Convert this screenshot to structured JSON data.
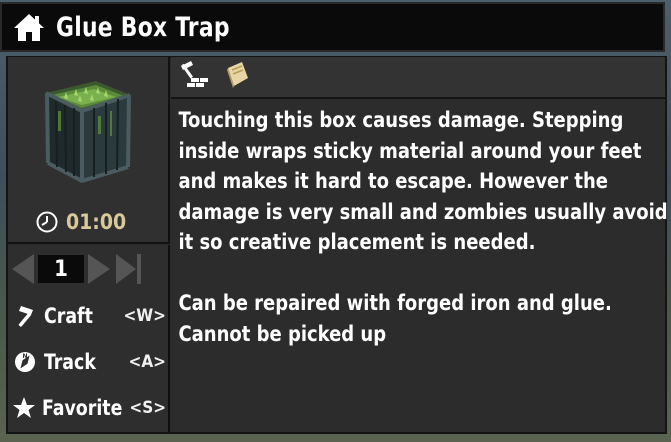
{
  "window": {
    "title": "Glue Box Trap"
  },
  "icons": {
    "home": "home-icon",
    "clock": "clock-icon",
    "craft_tab": "hammer-bricks-icon",
    "book_tab": "book-icon",
    "craft": "hammer-icon",
    "track": "compass-icon",
    "favorite": "star-icon"
  },
  "item": {
    "craft_time": "01:00",
    "quantity": "1"
  },
  "actions": [
    {
      "label": "Craft",
      "key": "<W>"
    },
    {
      "label": "Track",
      "key": "<A>"
    },
    {
      "label": "Favorite",
      "key": "<S>"
    }
  ],
  "description": {
    "paragraph1": "Touching this box causes damage. Stepping inside wraps sticky material around your feet and makes it hard to escape. However the damage is very small and zombies usually avoid it so creative placement is needed.",
    "paragraph2": "Can be repaired with forged iron and glue. Cannot be picked up"
  },
  "colors": {
    "title_bg": "#0a0a0a",
    "panel_bg": "#2b2b2b",
    "timer_text": "#d8c99a",
    "text": "#ffffff"
  }
}
